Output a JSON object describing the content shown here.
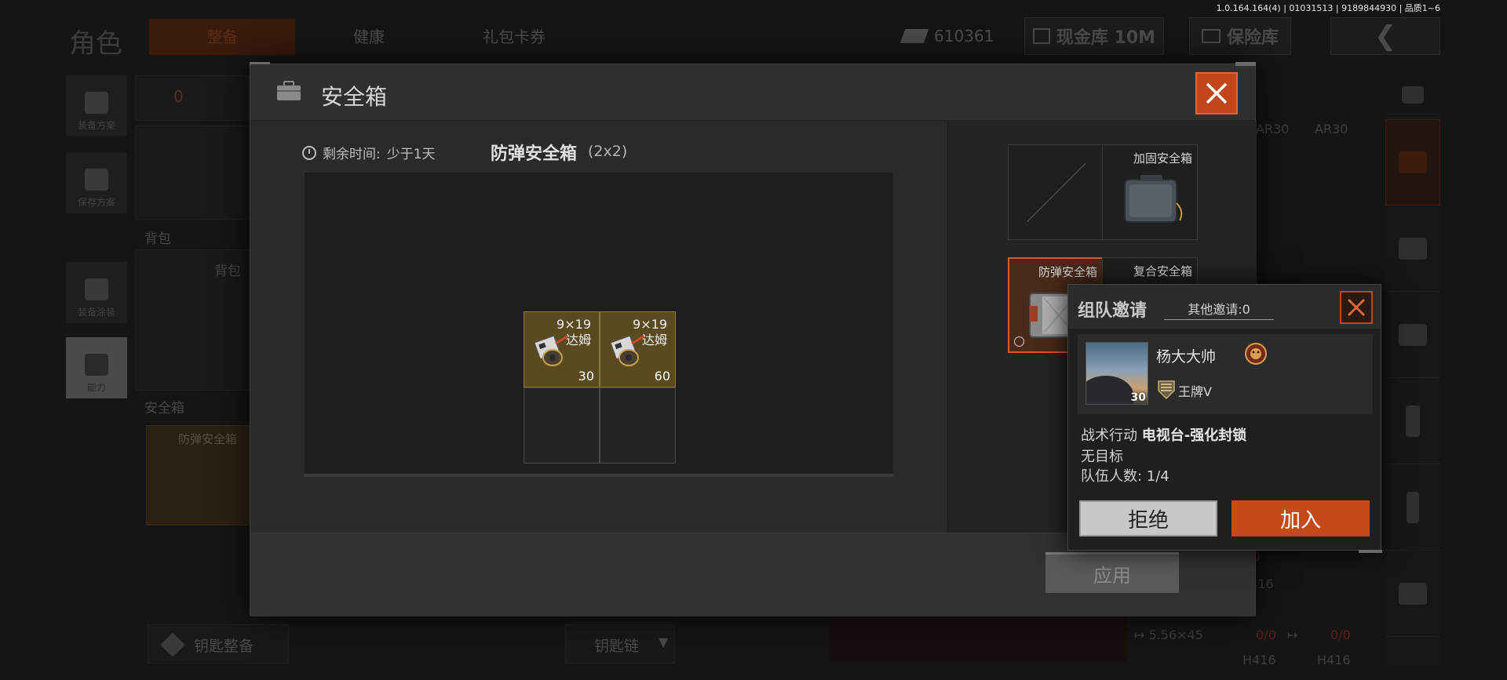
{
  "version": "1.0.164.164(4) | 01031513 | 9189844930 | 品质1~6",
  "background": {
    "title": "角色",
    "tabs": [
      "整备",
      "健康",
      "礼包卡券"
    ],
    "money": "610361",
    "cash_btn": "现金库 10M",
    "vault_btn": "保险库",
    "side_buttons": [
      "装备方案",
      "保存方案",
      "装备涂装",
      "能力"
    ],
    "helmet_count": "0",
    "backpack_label": "背包",
    "backpack_inner": "背包",
    "safebox_label": "安全箱",
    "safebox_item": "防弹安全箱",
    "key_btn": "钥匙整备",
    "keychain": "钥匙链",
    "ammo1": "AR30",
    "ammo2": "AR30",
    "weapon_ammo": "5.56×45",
    "weapon1": "H416",
    "weapon2": "H416",
    "counts": [
      "0/0",
      "0/0",
      "0/0"
    ]
  },
  "modal": {
    "title": "安全箱",
    "timer_label": "剩余时间:",
    "timer_value": "少于1天",
    "case_name": "防弹安全箱",
    "case_size": "(2x2)",
    "items": [
      {
        "caliber": "9×19",
        "name": "达姆",
        "qty": "30"
      },
      {
        "caliber": "9×19",
        "name": "达姆",
        "qty": "60"
      }
    ],
    "cases": [
      {
        "label": ""
      },
      {
        "label": "加固安全箱"
      },
      {
        "label": "防弹安全箱"
      },
      {
        "label": "复合安全箱"
      }
    ],
    "apply": "应用"
  },
  "invite": {
    "title": "组队邀请",
    "other": "其他邀请:0",
    "player_name": "杨大大帅",
    "level": "30",
    "rank": "王牌V",
    "mission_prefix": "战术行动",
    "mission_name": "电视台-强化封锁",
    "target": "无目标",
    "members": "队伍人数: 1/4",
    "reject": "拒绝",
    "join": "加入"
  },
  "colors": {
    "accent": "#c2461a",
    "join": "#c44a1c",
    "item_bg": "#5a4a20"
  }
}
